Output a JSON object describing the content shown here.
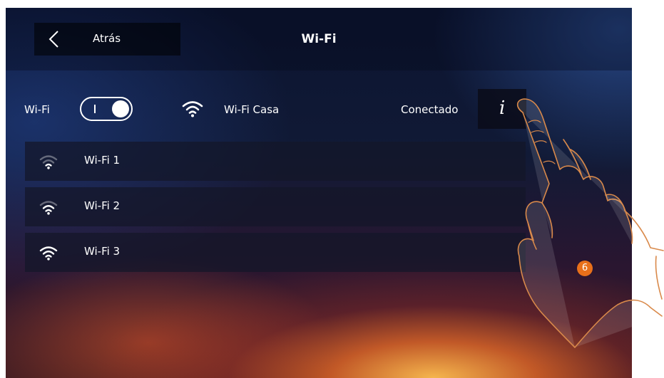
{
  "header": {
    "back_label": "Atrás",
    "title": "Wi-Fi"
  },
  "wifi_switch": {
    "label": "Wi-Fi",
    "enabled": true
  },
  "current_network": {
    "name": "Wi-Fi Casa",
    "status": "Conectado",
    "info_label": "i",
    "icon": "wifi-icon"
  },
  "networks": [
    {
      "name": "Wi-Fi 1",
      "icon": "wifi-icon"
    },
    {
      "name": "Wi-Fi 2",
      "icon": "wifi-icon"
    },
    {
      "name": "Wi-Fi 3",
      "icon": "wifi-icon"
    }
  ],
  "step_badge": "6",
  "colors": {
    "badge": "#e8701a",
    "text": "#ffffff"
  }
}
